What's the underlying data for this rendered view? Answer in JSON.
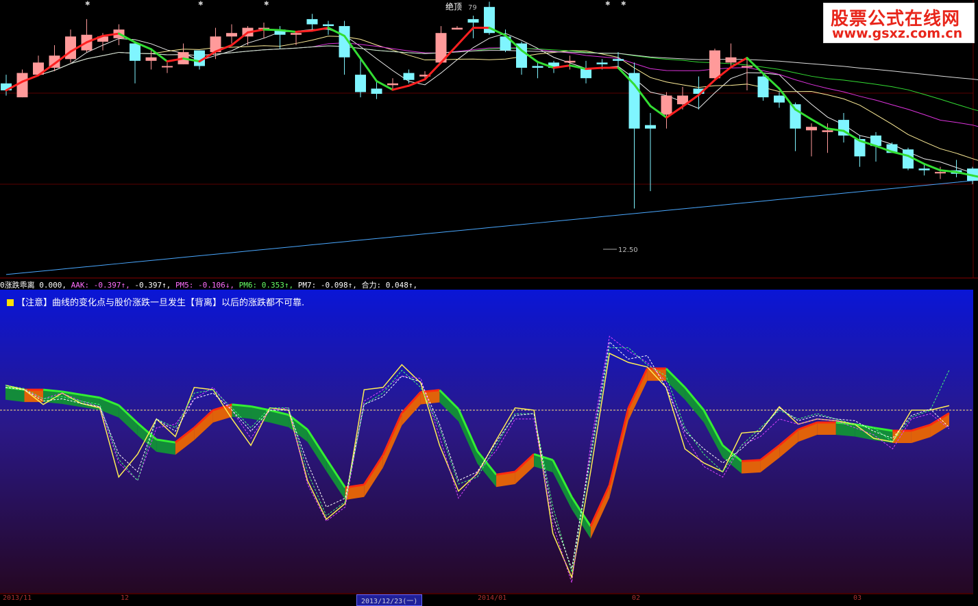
{
  "watermark": {
    "title": "股票公式在线网",
    "url": "www.gsxz.com.cn"
  },
  "indicator_line": [
    {
      "text": "0涨跌乖离 0.000,",
      "color": "#ffffff"
    },
    {
      "text": "AAK: -0.397↑,",
      "color": "#ff6fff"
    },
    {
      "text": " -0.397↑,",
      "color": "#ffffff"
    },
    {
      "text": "PM5: -0.106↓,",
      "color": "#ff6fff"
    },
    {
      "text": "PM6: 0.353↑,",
      "color": "#66ff66"
    },
    {
      "text": "PM7: -0.098↑,",
      "color": "#ffffff"
    },
    {
      "text": "合力: 0.048↑,",
      "color": "#ffffff"
    }
  ],
  "notice": "【注意】曲线的变化点与股价涨跌一旦发生【背离】以后的涨跌都不可靠.",
  "peak_label": "绝顶",
  "peak_value": "79",
  "low_marker": "12.50",
  "colors": {
    "up": "#ff9a9a",
    "down": "#7ff5ff",
    "ma_rise": "#ff2020",
    "ma_fall": "#33dd33",
    "band_up": "#e0620a",
    "band_down": "#138b3a"
  },
  "x_axis": [
    "2013/11",
    "12",
    "2013/12/23(一)",
    "2014/01",
    "02",
    "03"
  ],
  "chart_data": [
    {
      "type": "candlestick",
      "title": "",
      "ylim": [
        12.0,
        20.0
      ],
      "candles": [
        [
          17.6,
          17.4,
          17.85,
          17.25
        ],
        [
          17.2,
          17.9,
          18.0,
          17.2
        ],
        [
          17.85,
          18.2,
          18.4,
          17.95
        ],
        [
          18.05,
          18.4,
          18.7,
          17.95
        ],
        [
          18.3,
          18.95,
          19.15,
          18.2
        ],
        [
          18.55,
          19.0,
          19.45,
          18.5
        ],
        [
          18.8,
          18.95,
          19.05,
          18.55
        ],
        [
          18.9,
          19.15,
          19.3,
          18.7
        ],
        [
          18.75,
          18.25,
          18.8,
          17.6
        ],
        [
          18.25,
          18.35,
          18.55,
          18.0
        ],
        [
          18.1,
          18.1,
          18.2,
          17.9
        ],
        [
          18.15,
          18.5,
          18.75,
          18.15
        ],
        [
          18.55,
          18.1,
          18.5,
          18.0
        ],
        [
          18.5,
          18.95,
          19.2,
          18.3
        ],
        [
          18.95,
          19.05,
          19.3,
          18.75
        ],
        [
          18.95,
          19.2,
          19.25,
          18.7
        ],
        [
          19.2,
          19.2,
          19.35,
          18.9
        ],
        [
          19.15,
          19.0,
          19.25,
          18.6
        ],
        [
          19.0,
          19.05,
          19.1,
          18.7
        ],
        [
          19.45,
          19.3,
          19.6,
          19.15
        ],
        [
          19.3,
          19.25,
          19.4,
          19.0
        ],
        [
          19.25,
          18.35,
          19.4,
          17.85
        ],
        [
          17.85,
          17.35,
          18.3,
          17.2
        ],
        [
          17.45,
          17.3,
          17.65,
          17.15
        ],
        [
          17.55,
          17.6,
          17.75,
          17.45
        ],
        [
          17.9,
          17.7,
          18.0,
          17.6
        ],
        [
          17.8,
          17.85,
          17.95,
          17.75
        ],
        [
          18.2,
          19.05,
          19.25,
          18.2
        ],
        [
          19.15,
          19.2,
          19.25,
          19.15
        ],
        [
          19.45,
          19.35,
          19.55,
          18.9
        ],
        [
          19.8,
          19.05,
          19.95,
          19.0
        ],
        [
          18.95,
          18.55,
          19.15,
          18.5
        ],
        [
          18.75,
          18.05,
          18.8,
          17.85
        ],
        [
          18.1,
          18.05,
          18.2,
          17.75
        ],
        [
          18.2,
          18.05,
          18.25,
          17.9
        ],
        [
          18.2,
          18.25,
          18.4,
          18.0
        ],
        [
          18.05,
          17.75,
          18.25,
          17.6
        ],
        [
          18.2,
          18.15,
          18.3,
          18.0
        ],
        [
          18.3,
          18.25,
          18.5,
          18.1
        ],
        [
          17.9,
          16.3,
          18.2,
          14.0
        ],
        [
          16.4,
          16.3,
          16.75,
          14.5
        ],
        [
          16.7,
          17.25,
          17.35,
          16.3
        ],
        [
          17.0,
          17.25,
          17.5,
          16.85
        ],
        [
          17.45,
          17.3,
          17.8,
          16.85
        ],
        [
          17.75,
          18.55,
          18.6,
          17.7
        ],
        [
          18.2,
          18.35,
          18.75,
          18.1
        ],
        [
          18.1,
          18.1,
          18.3,
          17.4
        ],
        [
          17.8,
          17.2,
          17.9,
          17.1
        ],
        [
          17.25,
          17.05,
          17.35,
          16.9
        ],
        [
          17.0,
          16.3,
          17.05,
          15.65
        ],
        [
          16.25,
          16.35,
          16.45,
          15.5
        ],
        [
          16.2,
          16.25,
          16.45,
          15.6
        ],
        [
          16.55,
          16.1,
          16.75,
          15.9
        ],
        [
          16.0,
          15.5,
          16.1,
          15.2
        ],
        [
          16.1,
          15.8,
          16.2,
          15.35
        ],
        [
          15.85,
          15.6,
          15.9,
          15.6
        ],
        [
          15.7,
          15.15,
          15.75,
          15.1
        ],
        [
          15.15,
          15.1,
          15.3,
          14.95
        ],
        [
          15.05,
          15.05,
          15.2,
          14.85
        ],
        [
          15.1,
          15.0,
          15.4,
          14.9
        ],
        [
          15.15,
          14.8,
          15.2,
          14.7
        ],
        [
          14.85,
          14.75,
          14.95,
          14.7
        ]
      ]
    },
    {
      "type": "line",
      "title": "",
      "ylim": [
        -1.0,
        1.0
      ],
      "series": [
        {
          "name": "AAK",
          "values": [
            0.22,
            0.18,
            0.05,
            0.15,
            0.06,
            0.02,
            -0.38,
            -0.25,
            -0.05,
            -0.15,
            0.2,
            0.18,
            -0.05,
            -0.2,
            0.02,
            0.0,
            -0.4,
            -0.62,
            -0.53,
            0.18,
            0.2,
            0.4,
            0.24,
            -0.2,
            -0.46,
            -0.36,
            -0.17,
            0.02,
            0.0,
            -0.7,
            -0.95,
            -0.35,
            0.5,
            0.42,
            0.38,
            0.2,
            -0.22,
            -0.3,
            -0.35,
            -0.13,
            -0.12,
            0.03,
            -0.08,
            -0.05,
            -0.06,
            -0.08,
            -0.16,
            -0.18,
            0.0,
            0.0,
            0.04
          ]
        },
        {
          "name": "PM5",
          "values": [
            0.2,
            0.18,
            0.1,
            0.15,
            0.08,
            0.03,
            -0.3,
            -0.4,
            -0.1,
            -0.08,
            0.1,
            0.2,
            0.0,
            -0.16,
            0.0,
            0.02,
            -0.42,
            -0.63,
            -0.55,
            0.08,
            0.18,
            0.3,
            0.28,
            -0.15,
            -0.5,
            -0.35,
            -0.23,
            -0.05,
            -0.05,
            -0.65,
            -0.98,
            -0.2,
            0.65,
            0.52,
            0.42,
            0.25,
            -0.15,
            -0.32,
            -0.38,
            -0.2,
            -0.15,
            -0.05,
            -0.08,
            -0.05,
            -0.06,
            -0.1,
            -0.14,
            -0.22,
            -0.05,
            -0.02,
            -0.106
          ]
        },
        {
          "name": "PM6",
          "values": [
            0.22,
            0.19,
            0.1,
            0.12,
            0.08,
            0.05,
            -0.28,
            -0.4,
            -0.05,
            -0.1,
            0.15,
            0.18,
            0.02,
            -0.1,
            0.02,
            0.02,
            -0.35,
            -0.6,
            -0.52,
            0.05,
            0.15,
            0.35,
            0.2,
            -0.1,
            -0.42,
            -0.38,
            -0.2,
            -0.02,
            -0.02,
            -0.55,
            -0.92,
            -0.28,
            0.55,
            0.55,
            0.4,
            0.3,
            -0.1,
            -0.25,
            -0.35,
            -0.2,
            -0.1,
            0.0,
            -0.05,
            -0.02,
            -0.05,
            -0.08,
            -0.1,
            -0.18,
            -0.04,
            0.0,
            0.353
          ]
        },
        {
          "name": "PM7",
          "values": [
            0.2,
            0.18,
            0.08,
            0.1,
            0.06,
            0.03,
            -0.25,
            -0.35,
            -0.05,
            -0.12,
            0.1,
            0.15,
            0.0,
            -0.12,
            0.0,
            0.0,
            -0.3,
            -0.55,
            -0.5,
            0.05,
            0.12,
            0.3,
            0.25,
            -0.08,
            -0.4,
            -0.35,
            -0.18,
            -0.03,
            -0.02,
            -0.6,
            -0.9,
            -0.25,
            0.6,
            0.45,
            0.48,
            0.2,
            -0.12,
            -0.22,
            -0.3,
            -0.22,
            -0.12,
            0.02,
            -0.06,
            -0.03,
            -0.05,
            -0.06,
            -0.12,
            -0.16,
            -0.03,
            0.01,
            -0.098
          ]
        },
        {
          "name": "合力",
          "values": [
            0.2,
            0.18,
            0.16,
            0.15,
            0.1,
            0.08,
            -0.05,
            -0.25,
            -0.2,
            -0.1,
            0.0,
            0.1,
            0.05,
            -0.05,
            0.0,
            -0.03,
            -0.3,
            -0.5,
            -0.52,
            -0.25,
            0.0,
            0.2,
            0.28,
            0.05,
            -0.3,
            -0.45,
            -0.35,
            -0.25,
            -0.15,
            -0.45,
            -0.88,
            -0.65,
            0.25,
            0.45,
            0.4,
            0.25,
            -0.05,
            -0.2,
            -0.35,
            -0.32,
            -0.18,
            -0.1,
            -0.05,
            -0.06,
            -0.1,
            -0.08,
            -0.12,
            -0.15,
            -0.08,
            -0.02,
            0.048
          ]
        }
      ]
    }
  ]
}
